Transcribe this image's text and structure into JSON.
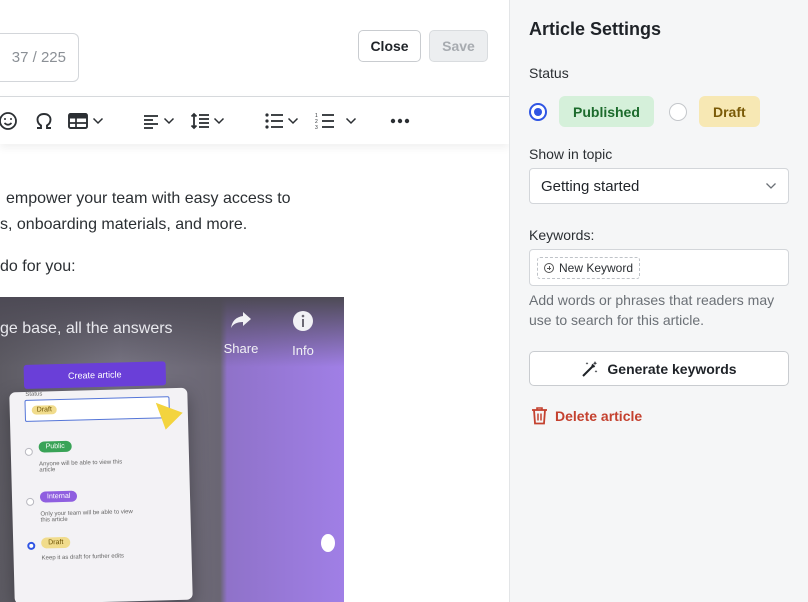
{
  "editor": {
    "title_counter": "37 / 225",
    "close_label": "Close",
    "save_label": "Save",
    "body_lines": [
      "empower your team with easy access to",
      "s, onboarding materials, and more.",
      "do for you:"
    ],
    "video": {
      "title": "ge base, all the answers",
      "share_label": "Share",
      "info_label": "Info",
      "mock_create": "Create article",
      "mock_status": "Status",
      "mock_draft": "Draft",
      "mock_public": "Public",
      "mock_public_desc": "Anyone will be able to view this article",
      "mock_internal": "Internal",
      "mock_internal_desc": "Only your team will be able to view this article",
      "mock_draft2": "Draft",
      "mock_draft_desc": "Keep it as draft for further edits"
    }
  },
  "panel": {
    "title": "Article Settings",
    "status_label": "Status",
    "status_options": [
      "Published",
      "Draft"
    ],
    "status_selected": "Published",
    "topic_label": "Show in topic",
    "topic_value": "Getting started",
    "keywords_label": "Keywords:",
    "new_keyword": "New Keyword",
    "keywords_hint": "Add words or phrases that readers may use to search for this article.",
    "generate_label": "Generate keywords",
    "delete_label": "Delete article"
  },
  "colors": {
    "accent_blue": "#2f55e4",
    "published_bg": "#d5f0da",
    "draft_bg": "#f7e8b4",
    "danger": "#c4412f"
  }
}
